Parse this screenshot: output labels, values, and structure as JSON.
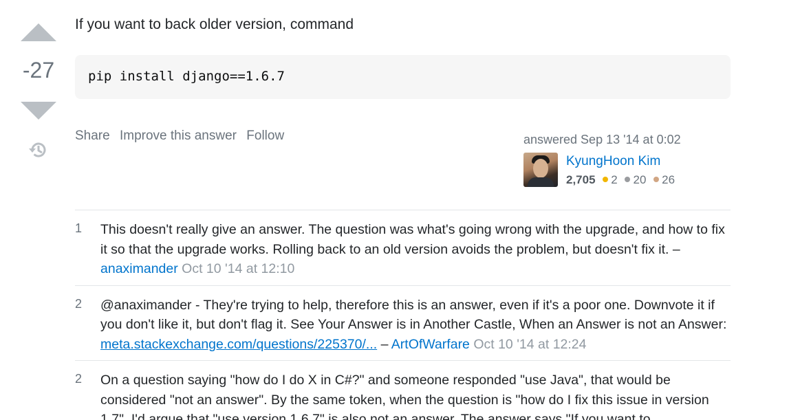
{
  "answer": {
    "vote_count": "-27",
    "text": "If you want to back older version, command",
    "code": "pip install django==1.6.7",
    "menu": {
      "share": "Share",
      "improve": "Improve this answer",
      "follow": "Follow"
    },
    "user": {
      "action": "answered Sep 13 '14 at 0:02",
      "name": "KyungHoon Kim",
      "reputation": "2,705",
      "gold": "2",
      "silver": "20",
      "bronze": "26",
      "gold_color": "#f1b600",
      "silver_color": "#9a9c9f",
      "bronze_color": "#d1a684"
    }
  },
  "comments": [
    {
      "score": "1",
      "text": "This doesn't really give an answer. The question was what's going wrong with the upgrade, and how to fix it so that the upgrade works. Rolling back to an old version avoids the problem, but doesn't fix it.",
      "sep": " – ",
      "user": "anaximander",
      "date": "Oct 10 '14 at 12:10"
    },
    {
      "score": "2",
      "text": "@anaximander - They're trying to help, therefore this is an answer, even if it's a poor one. Downvote it if you don't like it, but don't flag it. See Your Answer is in Another Castle, When an Answer is not an Answer: ",
      "link": "meta.stackexchange.com/questions/225370/...",
      "sep": " – ",
      "user": "ArtOfWarfare",
      "date": "Oct 10 '14 at 12:24"
    },
    {
      "score": "2",
      "text": "On a question saying \"how do I do X in C#?\" and someone responded \"use Java\", that would be considered \"not an answer\". By the same token, when the question is \"how do I fix this issue in version 1.7\", I'd argue that \"use version 1.6.7\" is also not an answer. The answer says \"If you want to"
    }
  ]
}
